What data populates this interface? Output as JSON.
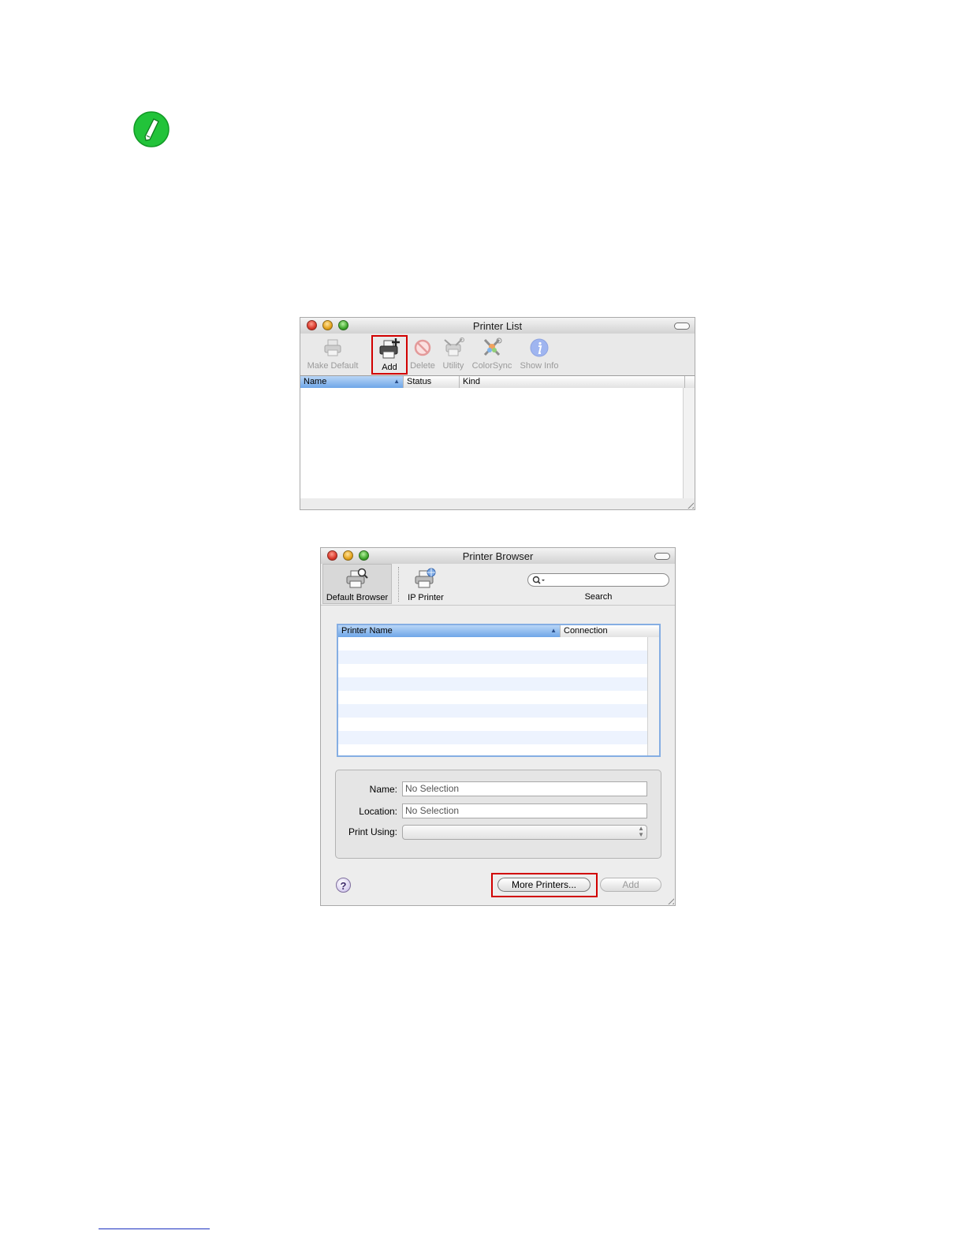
{
  "printer_list": {
    "title": "Printer List",
    "toolbar": {
      "make_default": "Make Default",
      "add": "Add",
      "delete": "Delete",
      "utility": "Utility",
      "colorsync": "ColorSync",
      "show_info": "Show Info"
    },
    "columns": {
      "name": "Name",
      "status": "Status",
      "kind": "Kind"
    }
  },
  "printer_browser": {
    "title": "Printer Browser",
    "toolbar": {
      "default_browser": "Default Browser",
      "ip_printer": "IP Printer",
      "search": "Search"
    },
    "columns": {
      "printer_name": "Printer Name",
      "connection": "Connection"
    },
    "form": {
      "name_label": "Name:",
      "name_value": "No Selection",
      "location_label": "Location:",
      "location_value": "No Selection",
      "print_using_label": "Print Using:"
    },
    "buttons": {
      "help": "?",
      "more_printers": "More Printers...",
      "add": "Add"
    }
  },
  "colors": {
    "highlight_box": "#d10000",
    "note_icon": "#22c33a",
    "sorted_column": "#6fa6e8"
  },
  "icons": {
    "note": "pencil-note-icon",
    "make_default": "printer-icon",
    "add": "printer-add-icon",
    "delete": "delete-icon",
    "utility": "utility-icon",
    "colorsync": "colorsync-icon",
    "show_info": "info-icon",
    "search": "search-icon"
  }
}
